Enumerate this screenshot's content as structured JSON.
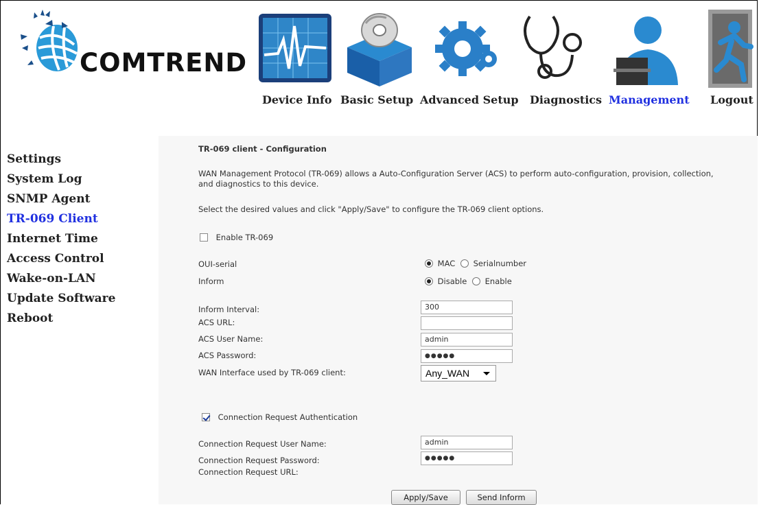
{
  "brand": {
    "name": "COMTREND"
  },
  "nav": {
    "items": [
      {
        "label": "Device Info",
        "icon": "monitor-graph-icon",
        "active": false
      },
      {
        "label": "Basic Setup",
        "icon": "box-disc-icon",
        "active": false
      },
      {
        "label": "Advanced Setup",
        "icon": "gears-icon",
        "active": false
      },
      {
        "label": "Diagnostics",
        "icon": "stethoscope-icon",
        "active": false
      },
      {
        "label": "Management",
        "icon": "user-laptop-icon",
        "active": true
      },
      {
        "label": "Logout",
        "icon": "exit-runner-icon",
        "active": false
      }
    ]
  },
  "sidebar": {
    "items": [
      {
        "label": "Settings",
        "active": false
      },
      {
        "label": "System Log",
        "active": false
      },
      {
        "label": "SNMP Agent",
        "active": false
      },
      {
        "label": "TR-069 Client",
        "active": true
      },
      {
        "label": "Internet Time",
        "active": false
      },
      {
        "label": "Access Control",
        "active": false
      },
      {
        "label": "Wake-on-LAN",
        "active": false
      },
      {
        "label": "Update Software",
        "active": false
      },
      {
        "label": "Reboot",
        "active": false
      }
    ]
  },
  "page": {
    "title": "TR-069 client - Configuration",
    "description": "WAN Management Protocol (TR-069) allows a Auto-Configuration Server (ACS) to perform auto-configuration, provision, collection, and diagnostics to this device.",
    "instruction": "Select the desired values and click \"Apply/Save\" to configure the TR-069 client options.",
    "enable_tr069": {
      "label": "Enable TR-069",
      "checked": false
    },
    "oui_serial": {
      "label": "OUI-serial",
      "options": [
        "MAC",
        "Serialnumber"
      ],
      "selected": "MAC"
    },
    "inform": {
      "label": "Inform",
      "options": [
        "Disable",
        "Enable"
      ],
      "selected": "Disable"
    },
    "inform_interval": {
      "label": "Inform Interval:",
      "value": "300"
    },
    "acs_url": {
      "label": "ACS URL:",
      "value": ""
    },
    "acs_user": {
      "label": "ACS User Name:",
      "value": "admin"
    },
    "acs_password": {
      "label": "ACS Password:",
      "value": "●●●●●"
    },
    "wan_interface": {
      "label": "WAN Interface used by TR-069 client:",
      "value": "Any_WAN"
    },
    "conn_auth": {
      "label": "Connection Request Authentication",
      "checked": true
    },
    "conn_user": {
      "label": "Connection Request User Name:",
      "value": "admin"
    },
    "conn_password": {
      "label": "Connection Request Password:",
      "value": "●●●●●"
    },
    "conn_url": {
      "label": "Connection Request URL:"
    },
    "apply_button": "Apply/Save",
    "inform_button": "Send Inform"
  },
  "colors": {
    "accent": "#2030e0",
    "panel_bg": "#f7f7f7"
  }
}
